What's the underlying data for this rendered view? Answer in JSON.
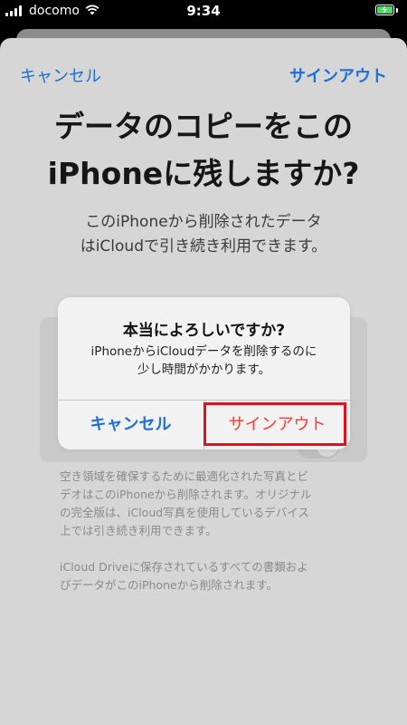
{
  "status_bar": {
    "carrier": "docomo",
    "time": "9:34",
    "battery_color": "#4cd964"
  },
  "nav": {
    "cancel_label": "キャンセル",
    "signout_label": "サインアウト"
  },
  "page": {
    "title_line1": "データのコピーをこの",
    "title_line2": "iPhoneに残しますか?",
    "subtitle_line1": "このiPhoneから削除されたデータ",
    "subtitle_line2": "はiCloudで引き続き利用できます。",
    "section_label": "",
    "footnote1_line1": "空き領域を確保するために最適化された写真とビ",
    "footnote1_line2": "デオはこのiPhoneから削除されます。オリジナル",
    "footnote1_line3": "の完全版は、iCloud写真を使用しているデバイス",
    "footnote1_line4": "上では引き続き利用できます。",
    "footnote2_line1": "iCloud Driveに保存されているすべての書類およ",
    "footnote2_line2": "びデータがこのiPhoneから削除されます。"
  },
  "alert": {
    "title": "本当によろしいですか?",
    "message_line1": "iPhoneからiCloudデータを削除するのに",
    "message_line2": "少し時間がかかります。",
    "cancel_label": "キャンセル",
    "signout_label": "サインアウト"
  },
  "colors": {
    "link_blue": "#1e6fd9",
    "destructive_red": "#ff3b30",
    "highlight_red": "#e0101d"
  }
}
